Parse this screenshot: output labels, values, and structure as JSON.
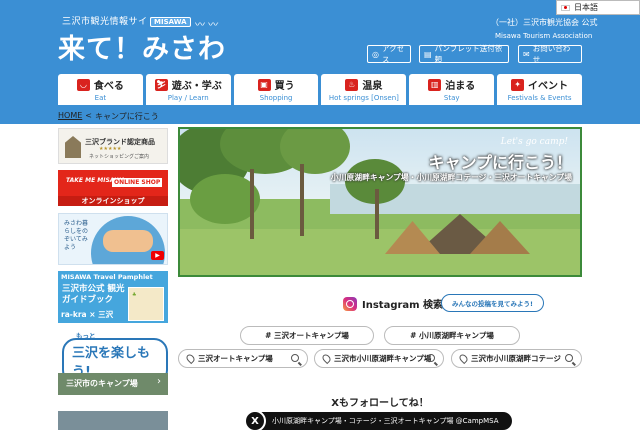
{
  "header": {
    "tagline": "三沢市観光情報サイト",
    "logo_text": "来て！みさわ",
    "logo_badge": "MISAWA",
    "org_name": "（一社）三沢市観光協会 公式",
    "org_name_en": "Misawa Tourism Association",
    "language": "日本語",
    "utility": [
      {
        "icon": "pin-icon",
        "label": "アクセス"
      },
      {
        "icon": "document-icon",
        "label": "パンフレット送付依頼"
      },
      {
        "icon": "mail-icon",
        "label": "お問い合わせ"
      }
    ]
  },
  "nav": [
    {
      "icon": "bowl-icon",
      "label": "食べる",
      "sub": "Eat"
    },
    {
      "icon": "ski-icon",
      "label": "遊ぶ・学ぶ",
      "sub": "Play / Learn"
    },
    {
      "icon": "bag-icon",
      "label": "買う",
      "sub": "Shopping"
    },
    {
      "icon": "hot-spring-icon",
      "label": "温泉",
      "sub": "Hot springs [Onsen]"
    },
    {
      "icon": "building-icon",
      "label": "泊まる",
      "sub": "Stay"
    },
    {
      "icon": "party-icon",
      "label": "イベント",
      "sub": "Festivals & Events"
    }
  ],
  "breadcrumb": {
    "home": "HOME",
    "separator": "<",
    "current": "キャンプに行こう"
  },
  "sidebar": {
    "brand_title": "三沢ブランド認定商品",
    "brand_sub": "ネットショッピングご案内",
    "shop_text": "TAKE ME MISAWA",
    "shop_badge": "ONLINE SHOP",
    "shop_label": "オンラインショップ",
    "video_text": "みさわ暮らしをのぞいてみよう",
    "pamph_title": "MISAWA Travel Pamphlet",
    "pamph_text": "三沢市公式 観光ガイドブック",
    "pamph_brand": "ra-kra × 三沢",
    "enjoy_top": "もっと",
    "enjoy_main": "三沢を楽しもう!",
    "camp_label": "三沢市のキャンプ場"
  },
  "hero": {
    "en": "Let's go camp!",
    "title": "キャンプに行こう！",
    "subtitle": "小川原湖畔キャンプ場・小川原湖畔コテージ・三沢オートキャンプ場"
  },
  "instagram": {
    "label": "Instagram 検索",
    "bubble": "みんなの投稿を見てみよう!",
    "hashtags": [
      "# 三沢オートキャンプ場",
      "# 小川原湖畔キャンプ場"
    ],
    "locations": [
      "三沢オートキャンプ場",
      "三沢市小川原湖畔キャンプ場",
      "三沢市小川原湖畔コテージ"
    ]
  },
  "x_follow": {
    "title": "Xもフォローしてね！",
    "icon_letter": "X",
    "account": "小川原湖畔キャンプ場・コテージ・三沢オートキャンプ場 @CampMSA"
  }
}
